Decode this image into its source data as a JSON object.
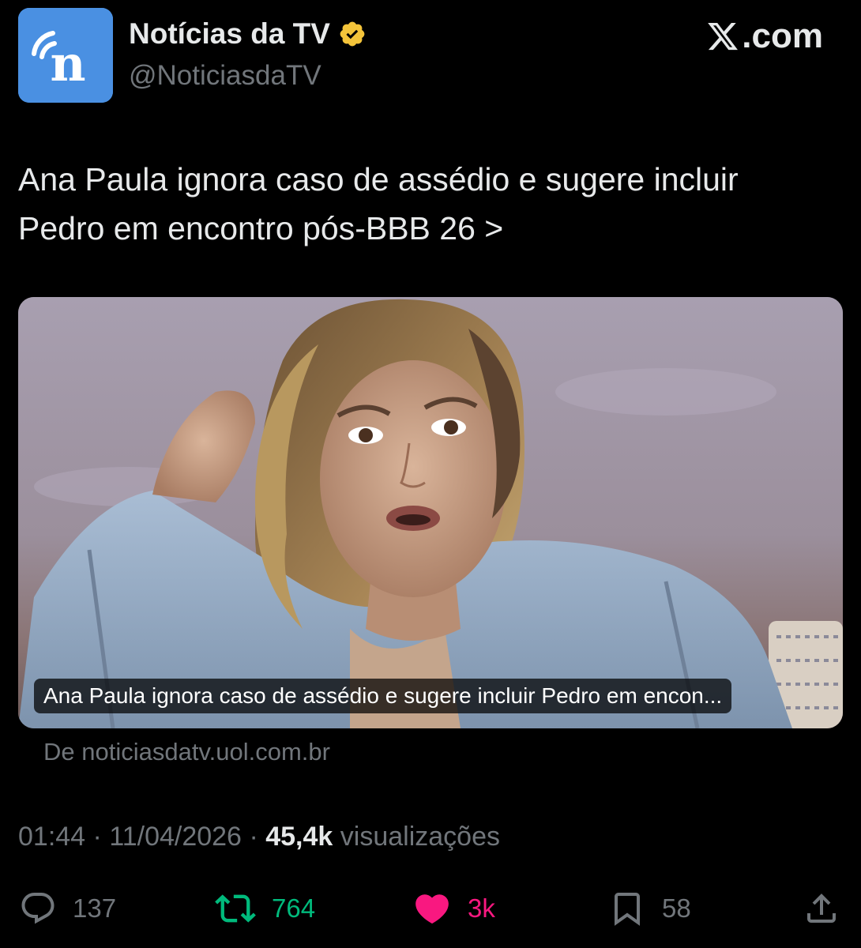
{
  "account": {
    "display_name": "Notícias da TV",
    "handle": "@NoticiasdaTV",
    "avatar_letter": "n",
    "avatar_color": "#4a90e2",
    "verified": true,
    "verified_color": "#f4c43a"
  },
  "brand": {
    "label": ".com",
    "icon": "x-logo-icon"
  },
  "tweet": {
    "text": "Ana Paula ignora caso de assédio e sugere incluir Pedro em encontro pós-BBB 26 >"
  },
  "card": {
    "caption": "Ana Paula ignora caso de assédio e sugere incluir Pedro em encon...",
    "source": "De noticiasdatv.uol.com.br"
  },
  "meta": {
    "time": "01:44",
    "date": "11/04/2026",
    "views": "45,4k",
    "views_label": "visualizações",
    "separator": "·"
  },
  "actions": {
    "replies": {
      "count": "137",
      "icon": "reply-icon",
      "color": "#71767b"
    },
    "reposts": {
      "count": "764",
      "icon": "repost-icon",
      "color": "#00ba7c"
    },
    "likes": {
      "count": "3k",
      "icon": "heart-icon",
      "color": "#f91880"
    },
    "bookmarks": {
      "count": "58",
      "icon": "bookmark-icon",
      "color": "#71767b"
    },
    "share": {
      "icon": "share-icon",
      "color": "#71767b"
    }
  }
}
